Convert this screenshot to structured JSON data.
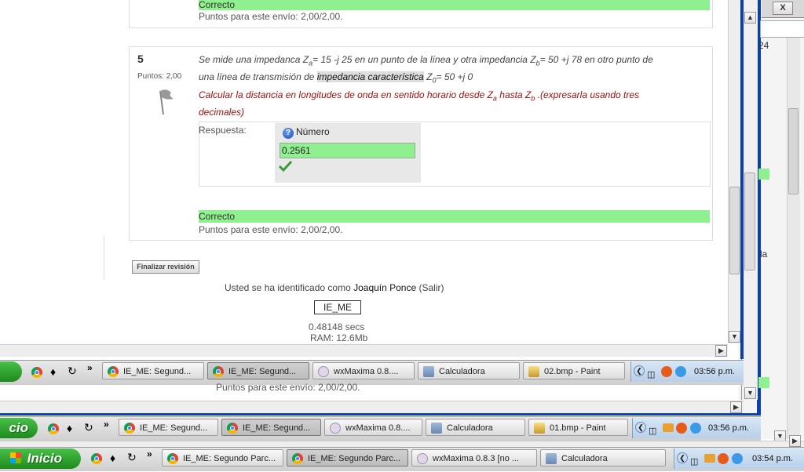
{
  "question5": {
    "number": "5",
    "points": "Puntos: 2,00",
    "text_part1": "Se mide una impedanca Z",
    "sub_a": "a",
    "text_part2": "= 15 -j 25 en un punto de la línea y otra impedancia Z",
    "sub_b": "b",
    "text_part3": "= 50 +j 78 en otro punto de",
    "text_line2_a": "una línea de transmisión de ",
    "highlighted": "impedancia característica",
    "text_line2_b": " Z",
    "sub_0": "0",
    "text_line2_c": "= 50 +j 0",
    "instruction_a": "Calcular la distancia en longitudes de onda en sentido horario desde Z",
    "instruction_b": " hasta Z",
    "instruction_c": " .(expresarla usando tres",
    "instruction_line2": "decimales)",
    "answer_label": "Respuesta:",
    "answer_type": "Número",
    "answer_value": "0.2561",
    "result": "Correcto",
    "score": "Puntos para este envío: 2,00/2,00."
  },
  "previous": {
    "result": "Correcto",
    "score": "Puntos para este envío: 2,00/2,00."
  },
  "finish_button": "Finalizar revisión",
  "footer": {
    "login_prefix": "Usted se ha identificado como ",
    "user": "Joaquín Ponce",
    "logout": "(Salir)",
    "course_button": "IE_ME",
    "time": "0.48148 secs",
    "ram": "RAM: 12.6Mb"
  },
  "behind_window": {
    "score": "Puntos para este envío: 2,00/2,00.",
    "fragment_24": "24",
    "fragment_la": "la"
  },
  "close_glyph": "X",
  "taskbar1": {
    "items": [
      {
        "label": "IE_ME: Segund...",
        "icon": "chrome-icon"
      },
      {
        "label": "IE_ME: Segund...",
        "icon": "chrome-icon"
      },
      {
        "label": "wxMaxima 0.8....",
        "icon": "wxmaxima-icon"
      },
      {
        "label": "Calculadora",
        "icon": "calculator-icon"
      },
      {
        "label": "02.bmp - Paint",
        "icon": "paint-icon"
      }
    ],
    "clock": "03:56 p.m."
  },
  "taskbar2": {
    "start": "cio",
    "items": [
      {
        "label": "IE_ME: Segund...",
        "icon": "chrome-icon"
      },
      {
        "label": "IE_ME: Segund...",
        "icon": "chrome-icon"
      },
      {
        "label": "wxMaxima 0.8....",
        "icon": "wxmaxima-icon"
      },
      {
        "label": "Calculadora",
        "icon": "calculator-icon"
      },
      {
        "label": "01.bmp - Paint",
        "icon": "paint-icon"
      }
    ],
    "clock": "03:56 p.m."
  },
  "taskbar3": {
    "start": "Inicio",
    "items": [
      {
        "label": "IE_ME: Segundo Parc...",
        "icon": "chrome-icon"
      },
      {
        "label": "IE_ME: Segundo Parc...",
        "icon": "chrome-icon"
      },
      {
        "label": "wxMaxima 0.8.3 [no ...",
        "icon": "wxmaxima-icon"
      },
      {
        "label": "Calculadora",
        "icon": "calculator-icon"
      }
    ],
    "clock": "03:54 p.m."
  },
  "colors": {
    "correct_bg": "#8ff08f",
    "feedback_red": "#a01010",
    "window_border": "#0a3fb0"
  }
}
